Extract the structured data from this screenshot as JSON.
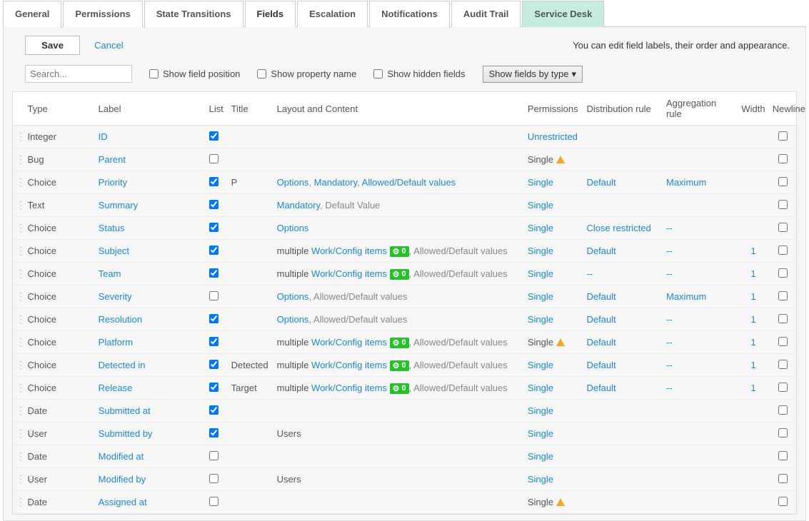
{
  "tabs": [
    "General",
    "Permissions",
    "State Transitions",
    "Fields",
    "Escalation",
    "Notifications",
    "Audit Trail",
    "Service Desk"
  ],
  "activeTab": 3,
  "highlightTab": 7,
  "toolbar": {
    "save": "Save",
    "cancel": "Cancel",
    "hint": "You can edit field labels, their order and appearance."
  },
  "filters": {
    "searchPlaceholder": "Search...",
    "showPosition": "Show field position",
    "showProperty": "Show property name",
    "showHidden": "Show hidden fields",
    "typeFilter": "Show fields by type"
  },
  "columns": {
    "type": "Type",
    "label": "Label",
    "list": "List",
    "title": "Title",
    "layout": "Layout and Content",
    "permissions": "Permissions",
    "distribution": "Distribution rule",
    "aggregation": "Aggregation rule",
    "width": "Width",
    "newline": "Newline"
  },
  "rows": [
    {
      "type": "Integer",
      "label": "ID",
      "list": true,
      "title": "",
      "layout": [],
      "permissions": {
        "text": "Unrestricted",
        "link": true,
        "warn": false
      },
      "dist": null,
      "agg": null,
      "width": "",
      "newline": false
    },
    {
      "type": "Bug",
      "label": "Parent",
      "list": false,
      "title": "",
      "layout": [],
      "permissions": {
        "text": "Single",
        "link": false,
        "warn": true
      },
      "dist": null,
      "agg": null,
      "width": "",
      "newline": false
    },
    {
      "type": "Choice",
      "label": "Priority",
      "list": true,
      "title": "P",
      "layout": [
        {
          "t": "link",
          "v": "Options"
        },
        {
          "t": "sep"
        },
        {
          "t": "link",
          "v": "Mandatory"
        },
        {
          "t": "sep"
        },
        {
          "t": "link",
          "v": "Allowed/Default values"
        }
      ],
      "permissions": {
        "text": "Single",
        "link": true,
        "warn": false
      },
      "dist": {
        "text": "Default"
      },
      "agg": {
        "text": "Maximum"
      },
      "width": "",
      "newline": false
    },
    {
      "type": "Text",
      "label": "Summary",
      "list": true,
      "title": "",
      "layout": [
        {
          "t": "link",
          "v": "Mandatory"
        },
        {
          "t": "sep"
        },
        {
          "t": "gray",
          "v": "Default Value"
        }
      ],
      "permissions": {
        "text": "Single",
        "link": true,
        "warn": false
      },
      "dist": null,
      "agg": null,
      "width": "",
      "newline": false
    },
    {
      "type": "Choice",
      "label": "Status",
      "list": true,
      "title": "",
      "layout": [
        {
          "t": "link",
          "v": "Options"
        }
      ],
      "permissions": {
        "text": "Single",
        "link": true,
        "warn": false
      },
      "dist": {
        "text": "Close restricted"
      },
      "agg": {
        "text": "--"
      },
      "width": "",
      "newline": false
    },
    {
      "type": "Choice",
      "label": "Subject",
      "list": true,
      "title": "",
      "layout": [
        {
          "t": "text",
          "v": "multiple "
        },
        {
          "t": "link",
          "v": "Work/Config items"
        },
        {
          "t": "badge",
          "v": "0"
        },
        {
          "t": "sep"
        },
        {
          "t": "gray",
          "v": "Allowed/Default values"
        }
      ],
      "permissions": {
        "text": "Single",
        "link": true,
        "warn": false
      },
      "dist": {
        "text": "Default"
      },
      "agg": {
        "text": "--"
      },
      "width": "1",
      "newline": false
    },
    {
      "type": "Choice",
      "label": "Team",
      "list": true,
      "title": "",
      "layout": [
        {
          "t": "text",
          "v": "multiple "
        },
        {
          "t": "link",
          "v": "Work/Config items"
        },
        {
          "t": "badge",
          "v": "0"
        },
        {
          "t": "sep"
        },
        {
          "t": "gray",
          "v": "Allowed/Default values"
        }
      ],
      "permissions": {
        "text": "Single",
        "link": true,
        "warn": false
      },
      "dist": {
        "text": "--"
      },
      "agg": {
        "text": "--"
      },
      "width": "1",
      "newline": false
    },
    {
      "type": "Choice",
      "label": "Severity",
      "list": false,
      "title": "",
      "layout": [
        {
          "t": "link",
          "v": "Options"
        },
        {
          "t": "sep"
        },
        {
          "t": "gray",
          "v": "Allowed/Default values"
        }
      ],
      "permissions": {
        "text": "Single",
        "link": true,
        "warn": false
      },
      "dist": {
        "text": "Default"
      },
      "agg": {
        "text": "Maximum"
      },
      "width": "1",
      "newline": false
    },
    {
      "type": "Choice",
      "label": "Resolution",
      "list": true,
      "title": "",
      "layout": [
        {
          "t": "link",
          "v": "Options"
        },
        {
          "t": "sep"
        },
        {
          "t": "gray",
          "v": "Allowed/Default values"
        }
      ],
      "permissions": {
        "text": "Single",
        "link": true,
        "warn": false
      },
      "dist": {
        "text": "Default"
      },
      "agg": {
        "text": "--"
      },
      "width": "1",
      "newline": false
    },
    {
      "type": "Choice",
      "label": "Platform",
      "list": true,
      "title": "",
      "layout": [
        {
          "t": "text",
          "v": "multiple "
        },
        {
          "t": "link",
          "v": "Work/Config items"
        },
        {
          "t": "badge",
          "v": "0"
        },
        {
          "t": "sep"
        },
        {
          "t": "gray",
          "v": "Allowed/Default values"
        }
      ],
      "permissions": {
        "text": "Single",
        "link": false,
        "warn": true
      },
      "dist": {
        "text": "Default"
      },
      "agg": {
        "text": "--"
      },
      "width": "1",
      "newline": false
    },
    {
      "type": "Choice",
      "label": "Detected in",
      "list": true,
      "title": "Detected",
      "layout": [
        {
          "t": "text",
          "v": "multiple "
        },
        {
          "t": "link",
          "v": "Work/Config items"
        },
        {
          "t": "badge",
          "v": "0"
        },
        {
          "t": "sep"
        },
        {
          "t": "gray",
          "v": "Allowed/Default values"
        }
      ],
      "permissions": {
        "text": "Single",
        "link": true,
        "warn": false
      },
      "dist": {
        "text": "Default"
      },
      "agg": {
        "text": "--"
      },
      "width": "1",
      "newline": false
    },
    {
      "type": "Choice",
      "label": "Release",
      "list": true,
      "title": "Target",
      "layout": [
        {
          "t": "text",
          "v": "multiple "
        },
        {
          "t": "link",
          "v": "Work/Config items"
        },
        {
          "t": "badge",
          "v": "0"
        },
        {
          "t": "sep"
        },
        {
          "t": "gray",
          "v": "Allowed/Default values"
        }
      ],
      "permissions": {
        "text": "Single",
        "link": true,
        "warn": false
      },
      "dist": {
        "text": "Default"
      },
      "agg": {
        "text": "--"
      },
      "width": "1",
      "newline": false
    },
    {
      "type": "Date",
      "label": "Submitted at",
      "list": true,
      "title": "",
      "layout": [],
      "permissions": {
        "text": "Single",
        "link": true,
        "warn": false
      },
      "dist": null,
      "agg": null,
      "width": "",
      "newline": false
    },
    {
      "type": "User",
      "label": "Submitted by",
      "list": true,
      "title": "",
      "layout": [
        {
          "t": "text",
          "v": " Users"
        }
      ],
      "permissions": {
        "text": "Single",
        "link": true,
        "warn": false
      },
      "dist": null,
      "agg": null,
      "width": "",
      "newline": false
    },
    {
      "type": "Date",
      "label": "Modified at",
      "list": false,
      "title": "",
      "layout": [],
      "permissions": {
        "text": "Single",
        "link": true,
        "warn": false
      },
      "dist": null,
      "agg": null,
      "width": "",
      "newline": false
    },
    {
      "type": "User",
      "label": "Modified by",
      "list": false,
      "title": "",
      "layout": [
        {
          "t": "text",
          "v": " Users"
        }
      ],
      "permissions": {
        "text": "Single",
        "link": true,
        "warn": false
      },
      "dist": null,
      "agg": null,
      "width": "",
      "newline": false
    },
    {
      "type": "Date",
      "label": "Assigned at",
      "list": false,
      "title": "",
      "layout": [],
      "permissions": {
        "text": "Single",
        "link": false,
        "warn": true
      },
      "dist": null,
      "agg": null,
      "width": "",
      "newline": false
    }
  ]
}
